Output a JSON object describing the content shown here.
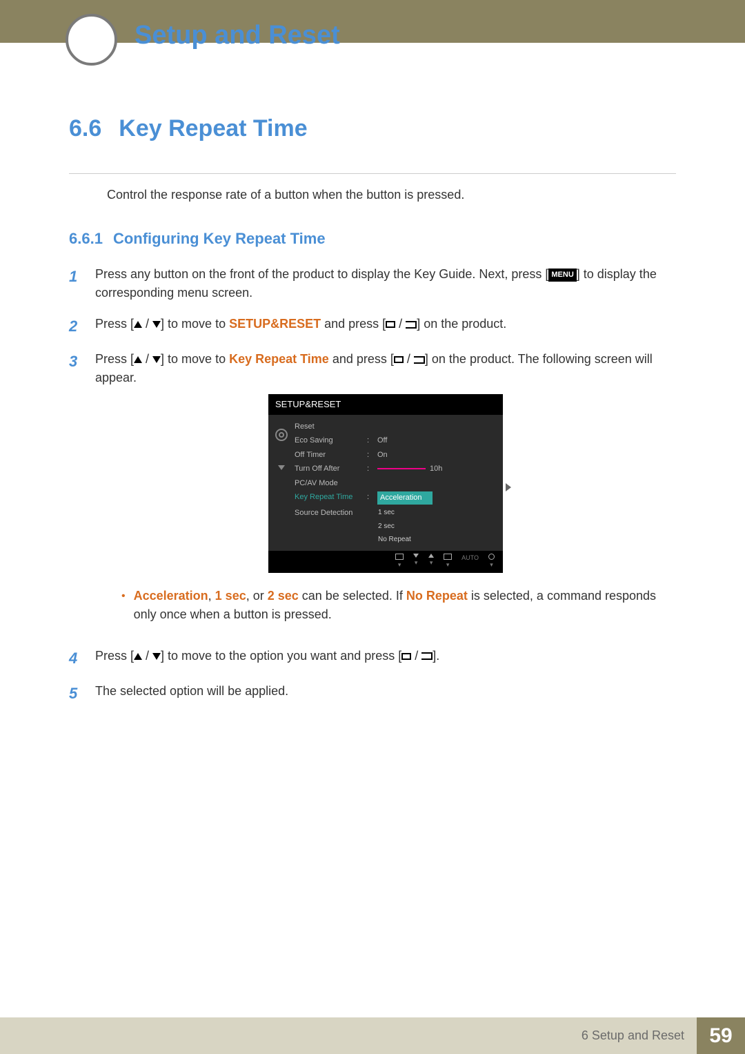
{
  "header": {
    "chapter_title": "Setup and Reset"
  },
  "section": {
    "number": "6.6",
    "title": "Key Repeat Time"
  },
  "intro": "Control the response rate of a button when the button is pressed.",
  "subsection": {
    "number": "6.6.1",
    "title": "Configuring Key Repeat Time"
  },
  "steps": {
    "s1_a": "Press any button on the front of the product to display the Key Guide. Next, press [",
    "s1_menu": "MENU",
    "s1_b": "] to display the corresponding menu screen.",
    "s2_a": "Press [",
    "s2_b": "] to move to ",
    "s2_target": "SETUP&RESET",
    "s2_c": " and press [",
    "s2_d": "] on the product.",
    "s3_a": "Press [",
    "s3_b": "] to move to ",
    "s3_target": "Key Repeat Time",
    "s3_c": " and press [",
    "s3_d": "] on the product. The following screen will appear.",
    "s4_a": "Press [",
    "s4_b": "] to move to the option you want and press [",
    "s4_c": "].",
    "s5": "The selected option will be applied."
  },
  "osd": {
    "title": "SETUP&RESET",
    "rows": {
      "reset": "Reset",
      "eco": "Eco Saving",
      "eco_val": "Off",
      "offtimer": "Off Timer",
      "offtimer_val": "On",
      "turnoff": "Turn Off After",
      "turnoff_val": "10h",
      "pcav": "PC/AV Mode",
      "keyrepeat": "Key Repeat Time",
      "source": "Source Detection"
    },
    "popup": {
      "opt1": "Acceleration",
      "opt2": "1 sec",
      "opt3": "2 sec",
      "opt4": "No Repeat"
    },
    "footer": {
      "auto": "AUTO"
    }
  },
  "bullet": {
    "a1": "Acceleration",
    "comma1": ", ",
    "a2": "1 sec",
    "mid": ", or ",
    "a3": "2 sec",
    "t1": " can be selected. If ",
    "a4": "No Repeat",
    "t2": " is selected, a command responds only once when a button is pressed."
  },
  "footer": {
    "label": "6 Setup and Reset",
    "page": "59"
  }
}
